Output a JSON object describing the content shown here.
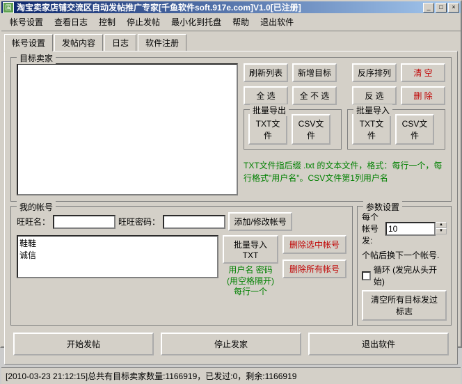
{
  "titlebar": {
    "icon": "国",
    "text": "淘宝卖家店铺交流区自动发帖推广专家[千鱼软件soft.917e.com]V1.0[已注册]"
  },
  "menu": {
    "items": [
      "帐号设置",
      "查看日志",
      "控制",
      "停止发帖",
      "最小化到托盘",
      "帮助",
      "退出软件"
    ]
  },
  "tabs": {
    "items": [
      "帐号设置",
      "发帖内容",
      "日志",
      "软件注册"
    ],
    "active": 0
  },
  "target_seller": {
    "legend": "目标卖家",
    "refresh": "刷新列表",
    "add_target": "新增目标",
    "reverse_sort": "反序排列",
    "clear": "清   空",
    "select_all": "全   选",
    "select_none": "全 不 选",
    "invert": "反   选",
    "delete": "删   除",
    "export": {
      "legend": "批量导出",
      "txt": "TXT文件",
      "csv": "CSV文件"
    },
    "import": {
      "legend": "批量导入",
      "txt": "TXT文件",
      "csv": "CSV文件"
    },
    "hint": "TXT文件指后缀 .txt 的文本文件，格式：每行一个，每行格式\"用户名\"。CSV文件第1列用户名"
  },
  "my_account": {
    "legend": "我的帐号",
    "wangwang_label": "旺旺名：",
    "password_label": "旺旺密码：",
    "add_modify": "添加/修改帐号",
    "batch_import": "批量导入TXT",
    "import_hint1": "用户名 密码",
    "import_hint2": "(用空格隔开)",
    "import_hint3": "每行一个",
    "delete_selected": "删除选中帐号",
    "delete_all": "删除所有帐号",
    "accounts": [
      "鞋鞋",
      "诚信"
    ]
  },
  "params": {
    "legend": "参数设置",
    "per_account_label": "每个帐号发:",
    "per_account_value": "10",
    "per_post_label": "个帖后换下一个帐号.",
    "loop_label": "循环 (发完从头开始)",
    "clear_flags": "清空所有目标发过标志"
  },
  "bottom": {
    "start": "开始发帖",
    "stop": "停止发家",
    "exit": "退出软件"
  },
  "statusbar": {
    "text": "[2010-03-23 21:12:15]总共有目标卖家数量:1166919，已发过:0，剩余:1166919"
  }
}
